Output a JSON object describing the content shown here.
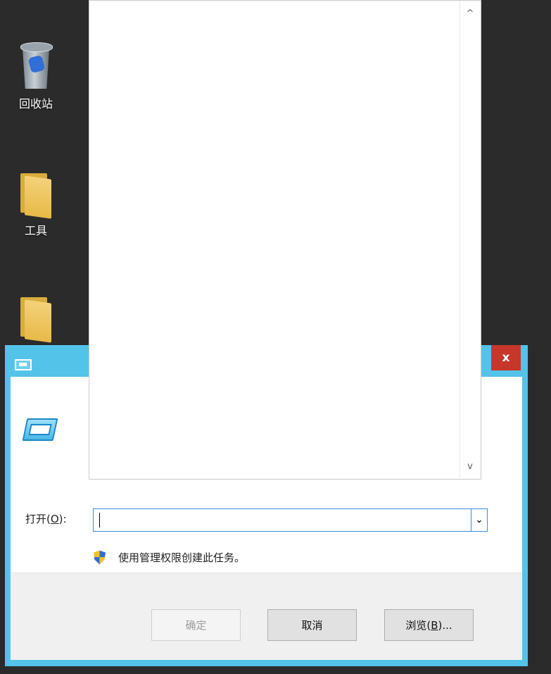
{
  "desktop": {
    "icons": [
      {
        "label": "回收站",
        "icon": "recycle-bin-icon"
      },
      {
        "label": "工具",
        "icon": "folder-icon"
      },
      {
        "label": "",
        "icon": "folder-icon"
      }
    ]
  },
  "dialog": {
    "close_label": "x",
    "open_label_prefix": "打开(",
    "open_label_key": "O",
    "open_label_suffix": "):",
    "command_value": "",
    "admin_text": "使用管理权限创建此任务。",
    "buttons": {
      "ok": "确定",
      "cancel": "取消",
      "browse_prefix": "浏览(",
      "browse_key": "B",
      "browse_suffix": ")..."
    }
  },
  "scroll": {
    "up": "^",
    "down": "v"
  },
  "colors": {
    "title_bar": "#54c3ea",
    "close": "#c7362b",
    "desktop": "#2b2b2b"
  }
}
